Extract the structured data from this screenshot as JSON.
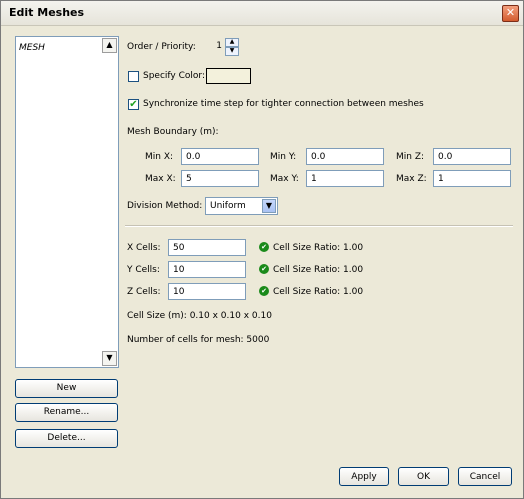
{
  "window": {
    "title": "Edit Meshes"
  },
  "sidebar": {
    "items": [
      "MESH"
    ],
    "buttons": {
      "new": "New",
      "rename": "Rename...",
      "delete": "Delete..."
    }
  },
  "order": {
    "label": "Order / Priority:",
    "value": "1"
  },
  "specify_color": {
    "label": "Specify Color:",
    "checked": false
  },
  "sync": {
    "label": "Synchronize time step for tighter connection between meshes",
    "checked": true
  },
  "boundary": {
    "label": "Mesh Boundary (m):",
    "min_x": {
      "label": "Min X:",
      "value": "0.0"
    },
    "min_y": {
      "label": "Min Y:",
      "value": "0.0"
    },
    "min_z": {
      "label": "Min Z:",
      "value": "0.0"
    },
    "max_x": {
      "label": "Max X:",
      "value": "5"
    },
    "max_y": {
      "label": "Max Y:",
      "value": "1"
    },
    "max_z": {
      "label": "Max Z:",
      "value": "1"
    }
  },
  "division": {
    "label": "Division Method:",
    "value": "Uniform"
  },
  "cells": {
    "x": {
      "label": "X Cells:",
      "value": "50",
      "ratio": "Cell Size Ratio: 1.00"
    },
    "y": {
      "label": "Y Cells:",
      "value": "10",
      "ratio": "Cell Size Ratio: 1.00"
    },
    "z": {
      "label": "Z Cells:",
      "value": "10",
      "ratio": "Cell Size Ratio: 1.00"
    }
  },
  "cell_size": "Cell Size (m): 0.10 x 0.10 x 0.10",
  "cell_count": "Number of cells for mesh: 5000",
  "footer": {
    "apply": "Apply",
    "ok": "OK",
    "cancel": "Cancel"
  }
}
